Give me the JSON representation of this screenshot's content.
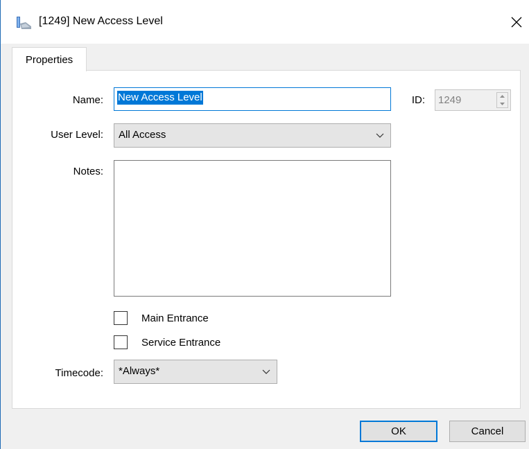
{
  "window": {
    "title": "[1249] New Access Level"
  },
  "icons": {
    "app": "access-level-icon",
    "close": "close-icon",
    "dropdown": "chevron-down-icon",
    "spin_up": "caret-up-icon",
    "spin_down": "caret-down-icon"
  },
  "colors": {
    "accent": "#0078d7",
    "window_bg": "#f0f0f0",
    "panel_bg": "#ffffff"
  },
  "tabs": [
    {
      "label": "Properties",
      "active": true
    }
  ],
  "form": {
    "name_label": "Name:",
    "name_value": "New Access Level",
    "id_label": "ID:",
    "id_value": "1249",
    "user_level_label": "User Level:",
    "user_level_value": "All Access",
    "notes_label": "Notes:",
    "notes_value": "",
    "checkboxes": [
      {
        "label": "Main Entrance",
        "checked": false
      },
      {
        "label": "Service Entrance",
        "checked": false
      }
    ],
    "timecode_label": "Timecode:",
    "timecode_value": "*Always*"
  },
  "buttons": {
    "ok": "OK",
    "cancel": "Cancel"
  }
}
